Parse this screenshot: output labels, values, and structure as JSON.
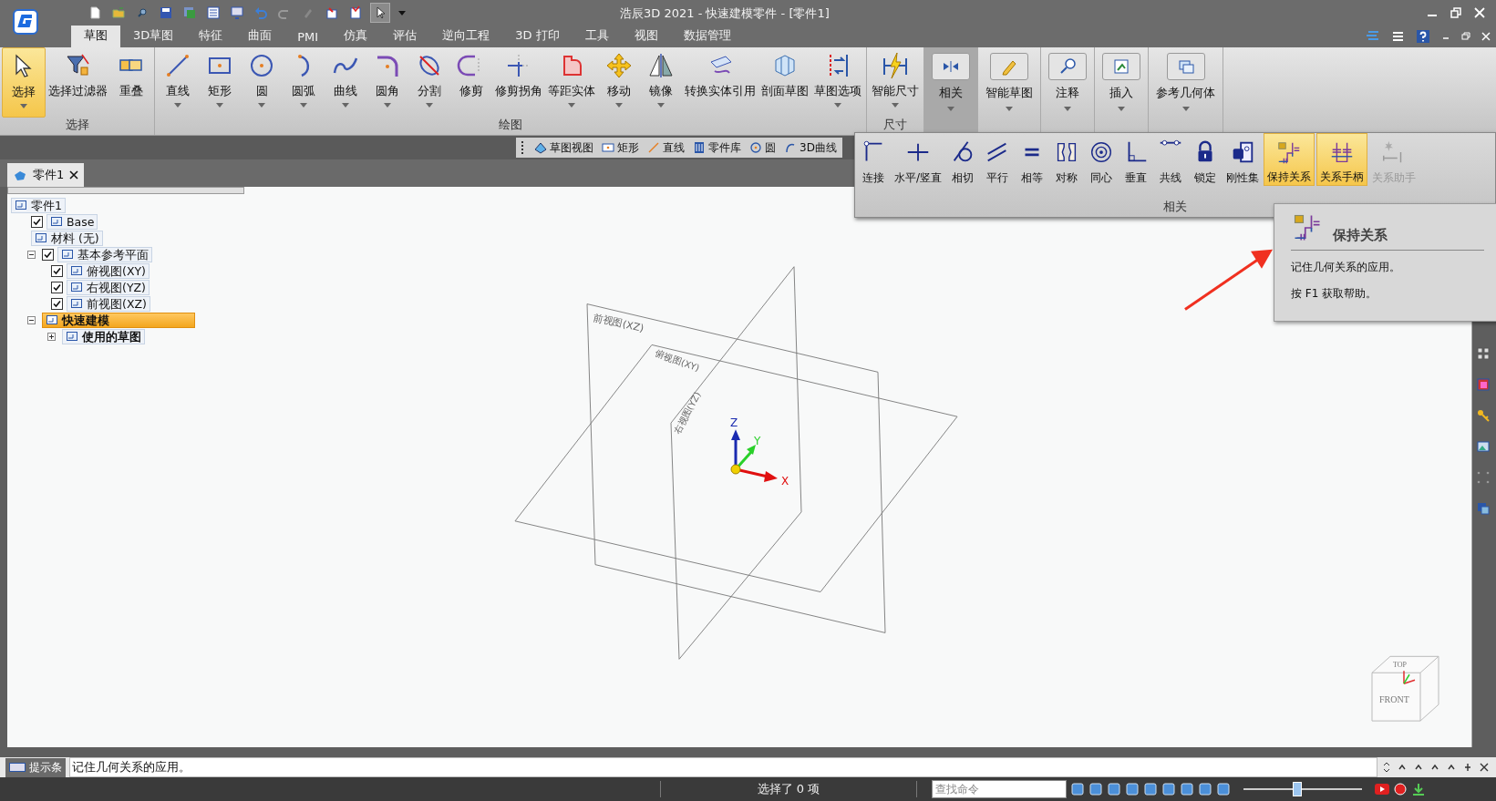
{
  "window": {
    "title": "浩辰3D 2021 - 快速建模零件 - [零件1]"
  },
  "ribbon_tabs": [
    {
      "label": "草图",
      "selected": true
    },
    {
      "label": "3D草图",
      "selected": false
    },
    {
      "label": "特征",
      "selected": false
    },
    {
      "label": "曲面",
      "selected": false
    },
    {
      "label": "PMI",
      "selected": false
    },
    {
      "label": "仿真",
      "selected": false
    },
    {
      "label": "评估",
      "selected": false
    },
    {
      "label": "逆向工程",
      "selected": false
    },
    {
      "label": "3D 打印",
      "selected": false
    },
    {
      "label": "工具",
      "selected": false
    },
    {
      "label": "视图",
      "selected": false
    },
    {
      "label": "数据管理",
      "selected": false
    }
  ],
  "ribbon_groups": [
    {
      "label": "选择",
      "tools": [
        {
          "label": "选择",
          "selected": true,
          "dropdown": true
        },
        {
          "label": "选择过滤器",
          "selected": false,
          "dropdown": false
        },
        {
          "label": "重叠",
          "selected": false,
          "dropdown": false
        }
      ]
    },
    {
      "label": "绘图",
      "tools": [
        {
          "label": "直线",
          "selected": false,
          "dropdown": true
        },
        {
          "label": "矩形",
          "selected": false,
          "dropdown": true
        },
        {
          "label": "圆",
          "selected": false,
          "dropdown": true
        },
        {
          "label": "圆弧",
          "selected": false,
          "dropdown": true
        },
        {
          "label": "曲线",
          "selected": false,
          "dropdown": true
        },
        {
          "label": "圆角",
          "selected": false,
          "dropdown": true
        },
        {
          "label": "分割",
          "selected": false,
          "dropdown": true
        },
        {
          "label": "修剪",
          "selected": false,
          "dropdown": false
        },
        {
          "label": "修剪拐角",
          "selected": false,
          "dropdown": false
        },
        {
          "label": "等距实体",
          "selected": false,
          "dropdown": true
        },
        {
          "label": "移动",
          "selected": false,
          "dropdown": true
        },
        {
          "label": "镜像",
          "selected": false,
          "dropdown": true
        },
        {
          "label": "转换实体引用",
          "selected": false,
          "dropdown": false
        },
        {
          "label": "剖面草图",
          "selected": false,
          "dropdown": false
        },
        {
          "label": "草图选项",
          "selected": false,
          "dropdown": true
        }
      ]
    },
    {
      "label": "尺寸",
      "tools": [
        {
          "label": "智能尺寸",
          "selected": false,
          "dropdown": true
        }
      ]
    }
  ],
  "collapsed_groups": [
    {
      "label": "相关",
      "selected": true
    },
    {
      "label": "智能草图",
      "selected": false
    },
    {
      "label": "注释",
      "selected": false
    },
    {
      "label": "插入",
      "selected": false
    },
    {
      "label": "参考几何体",
      "selected": false
    }
  ],
  "mini_toolbar": [
    "草图视图",
    "矩形",
    "直线",
    "零件库",
    "圆",
    "3D曲线"
  ],
  "document_tab": {
    "label": "零件1"
  },
  "tree": [
    {
      "label": "零件1",
      "kind": "plain",
      "selected": false,
      "bold": false,
      "children": [
        {
          "label": "Base",
          "kind": "check",
          "checked": true,
          "selected": false,
          "bold": false
        },
        {
          "label": "材料 (无)",
          "kind": "plain",
          "selected": false,
          "bold": false
        },
        {
          "label": "基本参考平面",
          "kind": "check",
          "checked": true,
          "expanded": true,
          "selected": false,
          "bold": false,
          "children": [
            {
              "label": "俯视图(XY)",
              "kind": "check",
              "checked": true,
              "selected": false,
              "bold": false
            },
            {
              "label": "右视图(YZ)",
              "kind": "check",
              "checked": true,
              "selected": false,
              "bold": false
            },
            {
              "label": "前视图(XZ)",
              "kind": "check",
              "checked": true,
              "selected": false,
              "bold": false
            }
          ]
        },
        {
          "label": "快速建模",
          "kind": "plain",
          "expanded": true,
          "selected": true,
          "bold": true,
          "children": [
            {
              "label": "使用的草图",
              "kind": "plain",
              "expanded": false,
              "selected": false,
              "bold": true
            }
          ]
        }
      ]
    }
  ],
  "relations_panel": {
    "title": "相关",
    "tools": [
      {
        "label": "连接",
        "selected": false,
        "disabled": false
      },
      {
        "label": "水平/竖直",
        "selected": false,
        "disabled": false
      },
      {
        "label": "相切",
        "selected": false,
        "disabled": false
      },
      {
        "label": "平行",
        "selected": false,
        "disabled": false
      },
      {
        "label": "相等",
        "selected": false,
        "disabled": false
      },
      {
        "label": "对称",
        "selected": false,
        "disabled": false
      },
      {
        "label": "同心",
        "selected": false,
        "disabled": false
      },
      {
        "label": "垂直",
        "selected": false,
        "disabled": false
      },
      {
        "label": "共线",
        "selected": false,
        "disabled": false
      },
      {
        "label": "锁定",
        "selected": false,
        "disabled": false
      },
      {
        "label": "刚性集",
        "selected": false,
        "disabled": false
      },
      {
        "label": "保持关系",
        "selected": true,
        "disabled": false
      },
      {
        "label": "关系手柄",
        "selected": true,
        "disabled": false
      },
      {
        "label": "关系助手",
        "selected": false,
        "disabled": true
      }
    ]
  },
  "tooltip": {
    "title": "保持关系",
    "description": "记住几何关系的应用。",
    "help": "按 F1 获取帮助。"
  },
  "viewport": {
    "planes": [
      "前视图(XZ)",
      "俯视图(XY)",
      "右视图(YZ)"
    ],
    "axes": [
      "X",
      "Y",
      "Z"
    ],
    "view_cube": {
      "front": "FRONT",
      "top": "TOP"
    }
  },
  "hint_bar": {
    "label": "提示条",
    "message": "记住几何关系的应用。"
  },
  "status_bar": {
    "selection": "选择了 0 项",
    "search_placeholder": "查找命令",
    "zoom": {
      "level": 0.45
    }
  }
}
